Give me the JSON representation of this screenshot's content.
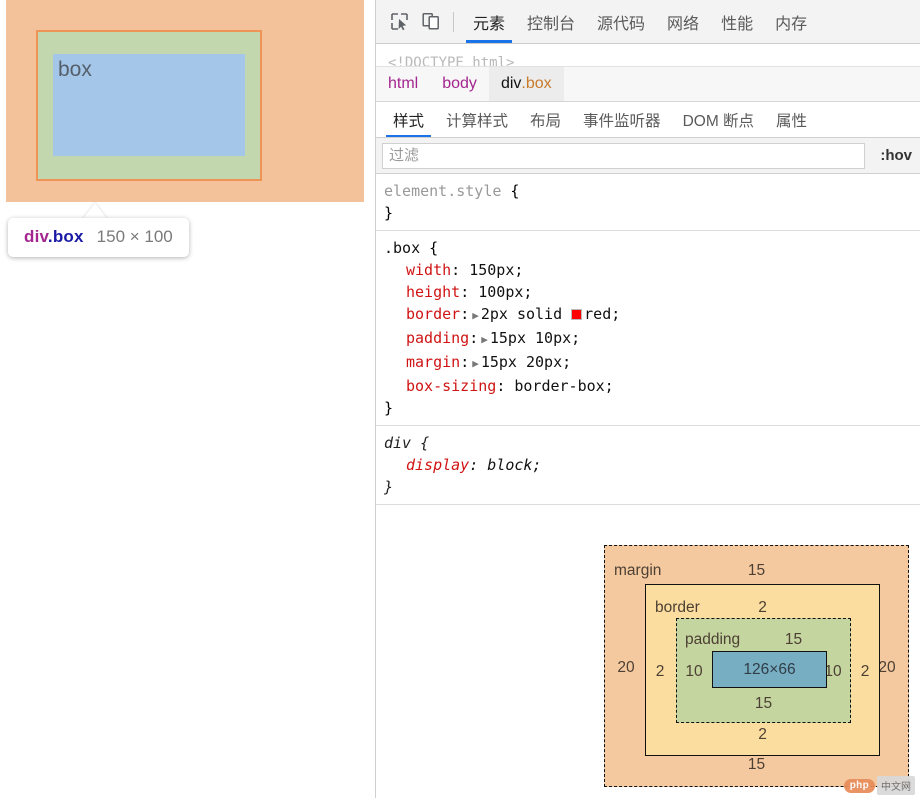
{
  "viewport": {
    "element_text": "box",
    "overlay": {
      "margin_color": "#f3c29a",
      "border_color": "#ed9456",
      "padding_color": "#c3d7ae",
      "content_color": "#a4c6e8"
    },
    "tooltip": {
      "tag": "div",
      "class": ".box",
      "dimensions": "150 × 100"
    }
  },
  "devtools": {
    "toolbar": {
      "inspect_icon": "inspect-element-icon",
      "device_icon": "device-toolbar-icon",
      "tabs": [
        {
          "label": "元素",
          "active": true
        },
        {
          "label": "控制台",
          "active": false
        },
        {
          "label": "源代码",
          "active": false
        },
        {
          "label": "网络",
          "active": false
        },
        {
          "label": "性能",
          "active": false
        },
        {
          "label": "内存",
          "active": false
        }
      ]
    },
    "dom_tree": {
      "clipped_line": "<!DOCTYPE html>"
    },
    "breadcrumb": [
      {
        "tag": "html",
        "class": "",
        "selected": false
      },
      {
        "tag": "body",
        "class": "",
        "selected": false
      },
      {
        "tag": "div",
        "class": ".box",
        "selected": true
      }
    ],
    "sub_tabs": [
      {
        "label": "样式",
        "active": true
      },
      {
        "label": "计算样式",
        "active": false
      },
      {
        "label": "布局",
        "active": false
      },
      {
        "label": "事件监听器",
        "active": false
      },
      {
        "label": "DOM 断点",
        "active": false
      },
      {
        "label": "属性",
        "active": false
      }
    ],
    "filter": {
      "value": "",
      "placeholder": "过滤",
      "hov_label": ":hov"
    },
    "rules": [
      {
        "selector": "element.style",
        "muted_selector": true,
        "italic": false,
        "declarations": []
      },
      {
        "selector": ".box",
        "muted_selector": false,
        "italic": false,
        "declarations": [
          {
            "property": "width",
            "value": "150px",
            "expandable": false,
            "swatch": ""
          },
          {
            "property": "height",
            "value": "100px",
            "expandable": false,
            "swatch": ""
          },
          {
            "property": "border",
            "value": "2px solid red",
            "expandable": true,
            "swatch": "#ff0000"
          },
          {
            "property": "padding",
            "value": "15px 10px",
            "expandable": true,
            "swatch": ""
          },
          {
            "property": "margin",
            "value": "15px 20px",
            "expandable": true,
            "swatch": ""
          },
          {
            "property": "box-sizing",
            "value": "border-box",
            "expandable": false,
            "swatch": ""
          }
        ]
      },
      {
        "selector": "div",
        "muted_selector": false,
        "italic": true,
        "declarations": [
          {
            "property": "display",
            "value": "block",
            "expandable": false,
            "swatch": ""
          }
        ]
      }
    ],
    "box_model": {
      "margin_label": "margin",
      "border_label": "border",
      "padding_label": "padding",
      "content_dimensions": "126×66",
      "margin_top": "15",
      "margin_right": "20",
      "margin_bottom": "15",
      "margin_left": "20",
      "border_top": "2",
      "border_right": "2",
      "border_bottom": "2",
      "border_left": "2",
      "padding_top": "15",
      "padding_right": "10",
      "padding_bottom": "15",
      "padding_left": "10",
      "colors": {
        "margin": "#f4c9a0",
        "border": "#fbdd9f",
        "padding": "#c4d5a0",
        "content": "#78aec2"
      }
    },
    "watermark": {
      "brand": "php",
      "site": "中文网"
    }
  }
}
